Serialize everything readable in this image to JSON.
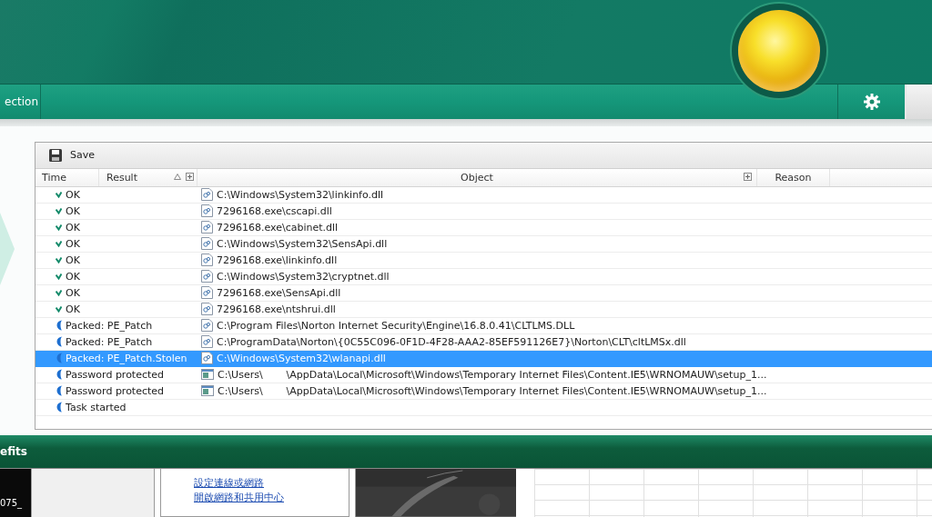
{
  "nav": {
    "tab_label": "ection"
  },
  "toolbar": {
    "save_label": "Save"
  },
  "table": {
    "columns": [
      "Time",
      "Result",
      "Object",
      "Reason"
    ],
    "rows": [
      {
        "kind": "ok",
        "result": "OK",
        "object": {
          "kind": "dll",
          "parts": [
            "C:\\Windows\\System32\\linkinfo.dll"
          ]
        },
        "selected": false
      },
      {
        "kind": "ok",
        "result": "OK",
        "object": {
          "kind": "dll",
          "parts": [
            "7296168.exe\\cscapi.dll"
          ]
        },
        "selected": false
      },
      {
        "kind": "ok",
        "result": "OK",
        "object": {
          "kind": "dll",
          "parts": [
            "7296168.exe\\cabinet.dll"
          ]
        },
        "selected": false
      },
      {
        "kind": "ok",
        "result": "OK",
        "object": {
          "kind": "dll",
          "parts": [
            "C:\\Windows\\System32\\SensApi.dll"
          ]
        },
        "selected": false
      },
      {
        "kind": "ok",
        "result": "OK",
        "object": {
          "kind": "dll",
          "parts": [
            "7296168.exe\\linkinfo.dll"
          ]
        },
        "selected": false
      },
      {
        "kind": "ok",
        "result": "OK",
        "object": {
          "kind": "dll",
          "parts": [
            "C:\\Windows\\System32\\cryptnet.dll"
          ]
        },
        "selected": false
      },
      {
        "kind": "ok",
        "result": "OK",
        "object": {
          "kind": "dll",
          "parts": [
            "7296168.exe\\SensApi.dll"
          ]
        },
        "selected": false
      },
      {
        "kind": "ok",
        "result": "OK",
        "object": {
          "kind": "dll",
          "parts": [
            "7296168.exe\\ntshrui.dll"
          ]
        },
        "selected": false
      },
      {
        "kind": "info",
        "result": "Packed: PE_Patch",
        "object": {
          "kind": "dll",
          "parts": [
            "C:\\Program Files\\Norton Internet Security\\Engine\\16.8.0.41\\CLTLMS.DLL"
          ]
        },
        "selected": false
      },
      {
        "kind": "info",
        "result": "Packed: PE_Patch",
        "object": {
          "kind": "dll",
          "parts": [
            "C:\\ProgramData\\Norton\\{0C55C096-0F1D-4F28-AAA2-85EF591126E7}\\Norton\\CLT\\cltLMSx.dll"
          ]
        },
        "selected": false
      },
      {
        "kind": "info",
        "result": "Packed: PE_Patch.Stolen",
        "object": {
          "kind": "dll",
          "parts": [
            "C:\\Windows\\System32\\wlanapi.dll"
          ]
        },
        "selected": true
      },
      {
        "kind": "info",
        "result": "Password protected",
        "object": {
          "kind": "exe",
          "parts": [
            "C:\\Users\\",
            "\\AppData\\Local\\Microsoft\\Windows\\Temporary Internet Files\\Content.IE5\\WRNOMAUW\\setup_1..."
          ]
        },
        "selected": false
      },
      {
        "kind": "info",
        "result": "Password protected",
        "object": {
          "kind": "exe",
          "parts": [
            "C:\\Users\\",
            "\\AppData\\Local\\Microsoft\\Windows\\Temporary Internet Files\\Content.IE5\\WRNOMAUW\\setup_1..."
          ]
        },
        "selected": false
      },
      {
        "kind": "info",
        "result": "Task started",
        "selected": false
      }
    ]
  },
  "footer": {
    "label": "efits"
  },
  "desktop": {
    "icon_label": "075_",
    "links": [
      "設定連線或網路",
      "開啟網路和共用中心"
    ]
  }
}
